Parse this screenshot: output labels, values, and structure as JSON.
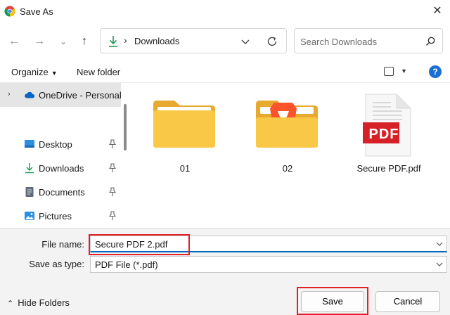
{
  "window": {
    "title": "Save As"
  },
  "address_bar": {
    "path": "Downloads",
    "separator": "›"
  },
  "search": {
    "placeholder": "Search Downloads"
  },
  "toolbar": {
    "organize_label": "Organize",
    "new_folder_label": "New folder",
    "help_label": "?"
  },
  "sidebar": {
    "items": [
      {
        "label": "OneDrive - Personal",
        "icon": "cloud-icon",
        "selected": true
      },
      {
        "label": "Desktop",
        "icon": "desktop-icon",
        "pinned": true
      },
      {
        "label": "Downloads",
        "icon": "download-icon",
        "pinned": true
      },
      {
        "label": "Documents",
        "icon": "document-icon",
        "pinned": true
      },
      {
        "label": "Pictures",
        "icon": "pictures-icon",
        "pinned": true
      }
    ]
  },
  "files": [
    {
      "name": "01",
      "type": "folder"
    },
    {
      "name": "02",
      "type": "folder"
    },
    {
      "name": "Secure PDF.pdf",
      "type": "pdf",
      "badge": "PDF"
    }
  ],
  "save_panel": {
    "file_name_label": "File name:",
    "file_name_value": "Secure PDF 2.pdf",
    "save_as_type_label": "Save as type:",
    "save_as_type_value": "PDF File (*.pdf)",
    "hide_folders_label": "Hide Folders",
    "save_label": "Save",
    "cancel_label": "Cancel"
  },
  "colors": {
    "accent": "#0067c0",
    "highlight": "#e0202a",
    "folder": "#f8c846",
    "pdf_red": "#d62027"
  }
}
